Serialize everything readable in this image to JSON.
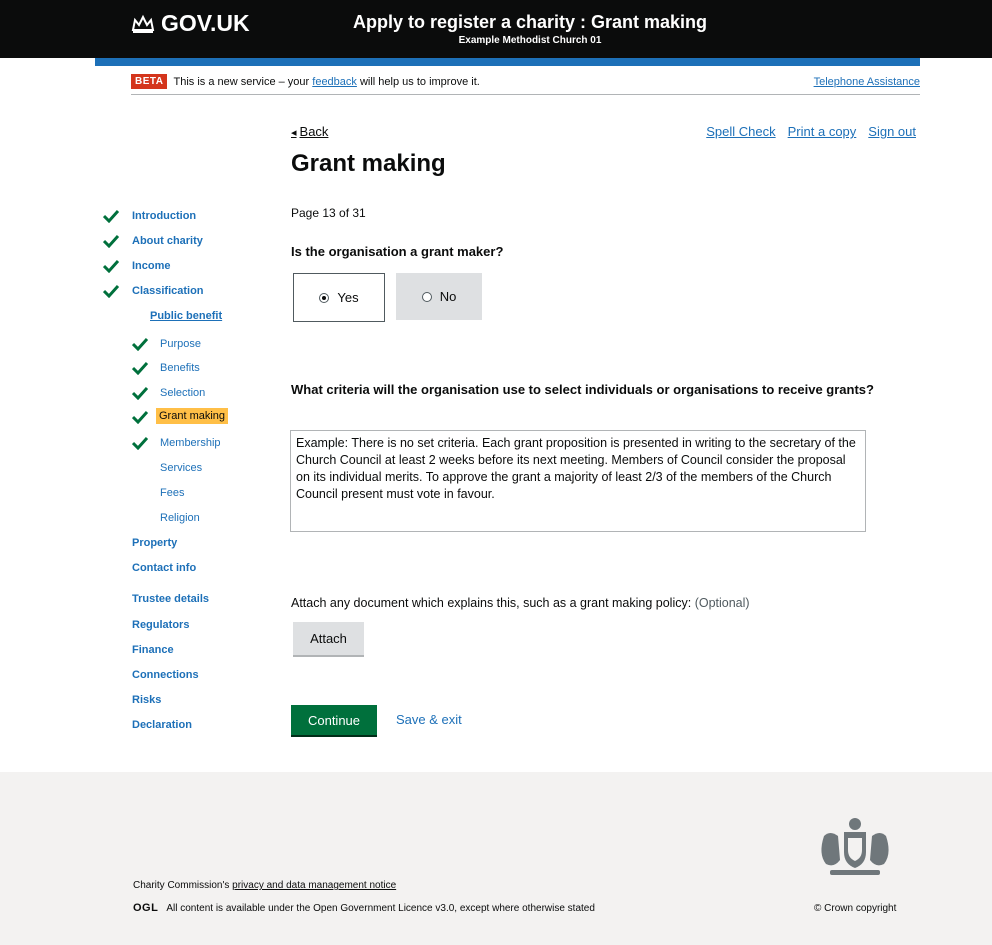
{
  "header": {
    "logo_text": "GOV.UK",
    "service_title": "Apply to register a charity : Grant making",
    "service_subtitle": "Example Methodist Church 01"
  },
  "beta": {
    "tag": "BETA",
    "text_before": "This is a new service – your ",
    "feedback_link": "feedback",
    "text_after": " will help us to improve it.",
    "telephone_link": "Telephone Assistance"
  },
  "toolbar": {
    "back": "Back",
    "spell_check": "Spell Check",
    "print": "Print a copy",
    "sign_out": "Sign out"
  },
  "page": {
    "title": "Grant making",
    "page_of": "Page 13 of 31"
  },
  "sidebar": {
    "items": [
      {
        "label": "Introduction",
        "done": true
      },
      {
        "label": "About charity",
        "done": true
      },
      {
        "label": "Income",
        "done": true
      },
      {
        "label": "Classification",
        "done": true
      },
      {
        "label": "Public benefit"
      },
      {
        "label": "Purpose",
        "done": true
      },
      {
        "label": "Benefits",
        "done": true
      },
      {
        "label": "Selection",
        "done": true
      },
      {
        "label": "Grant making",
        "done": true,
        "current": true
      },
      {
        "label": "Membership",
        "done": true
      },
      {
        "label": "Services"
      },
      {
        "label": "Fees"
      },
      {
        "label": "Religion"
      },
      {
        "label": "Property"
      },
      {
        "label": "Contact info"
      },
      {
        "label": "Trustee details"
      },
      {
        "label": "Regulators"
      },
      {
        "label": "Finance"
      },
      {
        "label": "Connections"
      },
      {
        "label": "Risks"
      },
      {
        "label": "Declaration"
      }
    ]
  },
  "question1": {
    "label": "Is the organisation a grant maker?",
    "options": [
      "Yes",
      "No"
    ],
    "selected": "Yes"
  },
  "question2": {
    "label": "What criteria will the organisation use to select individuals or organisations to receive grants?",
    "value": "Example: There is no set criteria. Each grant proposition is presented in writing to the secretary of the Church Council at least 2 weeks before its next meeting. Members of Council consider the proposal on its individual merits. To approve the grant a majority of least 2/3 of the members of the Church Council present must vote in favour."
  },
  "attach": {
    "label": "Attach any document which explains this, such as a grant making policy: ",
    "optional": "(Optional)",
    "button": "Attach"
  },
  "actions": {
    "continue": "Continue",
    "save_exit": "Save & exit"
  },
  "footer": {
    "privacy_prefix": "Charity Commission's ",
    "privacy_link": "privacy and data management notice",
    "ogl_logo": "OGL",
    "ogl_text": "All content is available under the Open Government Licence v3.0, except where otherwise stated",
    "crown_copyright": "© Crown copyright"
  }
}
